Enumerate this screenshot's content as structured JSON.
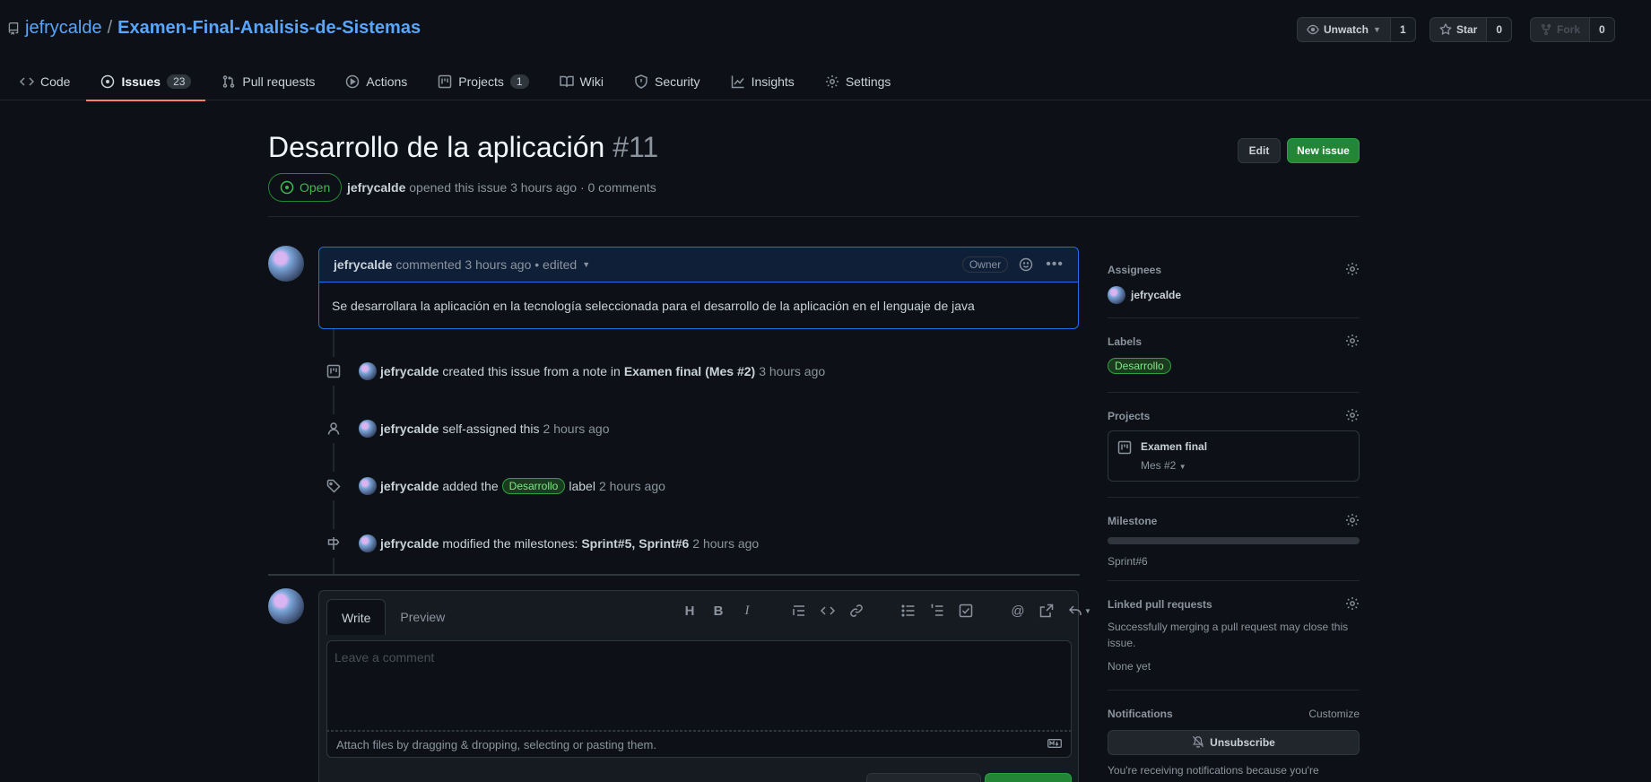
{
  "repo": {
    "owner": "jefrycalde",
    "separator": "/",
    "name": "Examen-Final-Analisis-de-Sistemas"
  },
  "repo_actions": {
    "watch": {
      "label": "Unwatch",
      "count": "1"
    },
    "star": {
      "label": "Star",
      "count": "0"
    },
    "fork": {
      "label": "Fork",
      "count": "0"
    }
  },
  "tabs": [
    {
      "label": "Code"
    },
    {
      "label": "Issues",
      "count": "23"
    },
    {
      "label": "Pull requests"
    },
    {
      "label": "Actions"
    },
    {
      "label": "Projects",
      "count": "1"
    },
    {
      "label": "Wiki"
    },
    {
      "label": "Security"
    },
    {
      "label": "Insights"
    },
    {
      "label": "Settings"
    }
  ],
  "issue": {
    "title": "Desarrollo de la aplicación",
    "number": "#11",
    "state": "Open",
    "author": "jefrycalde",
    "meta_text": "opened this issue 3 hours ago · 0 comments",
    "edit_label": "Edit",
    "new_issue_label": "New issue"
  },
  "comment": {
    "author": "jefrycalde",
    "meta": "commented 3 hours ago • edited",
    "role": "Owner",
    "body": "Se desarrollara la aplicación en la tecnología seleccionada para el desarrollo de la aplicación en el lenguaje de java"
  },
  "timeline": [
    {
      "user": "jefrycalde",
      "t1": "created this issue from a note in",
      "b1": "Examen final",
      "paren": "(Mes #2)",
      "time": "3 hours ago"
    },
    {
      "user": "jefrycalde",
      "t1": "self-assigned this",
      "time": "2 hours ago"
    },
    {
      "user": "jefrycalde",
      "t1": "added the",
      "label": "Desarrollo",
      "t2": "label",
      "time": "2 hours ago"
    },
    {
      "user": "jefrycalde",
      "t1": "modified the milestones:",
      "b1": "Sprint#5",
      "b2": "Sprint#6",
      "comma": ",",
      "time": "2 hours ago"
    }
  ],
  "composer": {
    "write_tab": "Write",
    "preview_tab": "Preview",
    "placeholder": "Leave a comment",
    "attach_text": "Attach files by dragging & dropping, selecting or pasting them."
  },
  "sidebar": {
    "assignees": {
      "title": "Assignees",
      "user": "jefrycalde"
    },
    "labels": {
      "title": "Labels",
      "label": "Desarrollo"
    },
    "projects": {
      "title": "Projects",
      "name": "Examen final",
      "column": "Mes #2"
    },
    "milestone": {
      "title": "Milestone",
      "name": "Sprint#6",
      "progress": 0
    },
    "linked_prs": {
      "title": "Linked pull requests",
      "desc": "Successfully merging a pull request may close this issue.",
      "none": "None yet"
    },
    "notifications": {
      "title": "Notifications",
      "customize": "Customize",
      "unsubscribe": "Unsubscribe",
      "reason": "You're receiving notifications because you're watching this repository."
    }
  },
  "colors": {
    "accent": "#58a6ff",
    "open": "#3fb950",
    "primary_button": "#238636",
    "active_tab": "#f78166"
  }
}
